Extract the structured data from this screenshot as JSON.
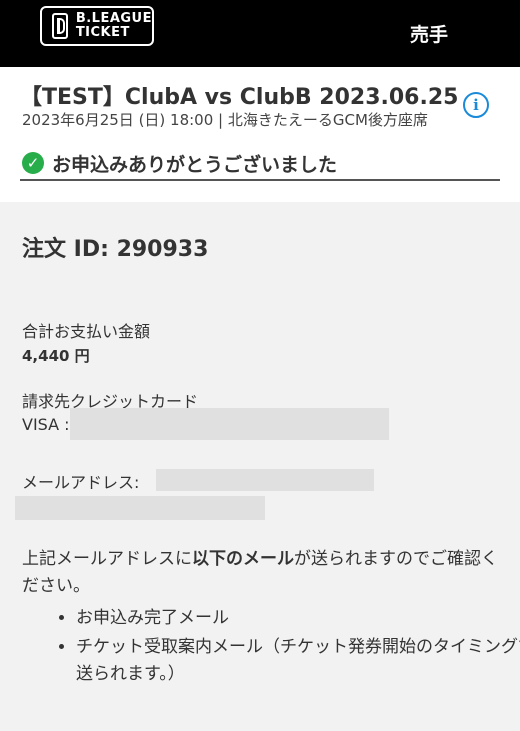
{
  "header": {
    "logo_line1": "B.LEAGUE",
    "logo_line2": "TICKET",
    "seller_label": "売手"
  },
  "event": {
    "title": "【TEST】ClubA vs ClubB 2023.06.25",
    "subtitle": "2023年6月25日 (日) 18:00 | 北海きたえーるGCM後方座席",
    "info_icon": "i"
  },
  "confirmation": {
    "message": "お申込みありがとうございました",
    "check_icon": "✓"
  },
  "order": {
    "id_label": "注文 ID: 290933",
    "total_label": "合計お支払い金額",
    "total_value": "4,440 円",
    "card_label": "請求先クレジットカード",
    "card_prefix": "VISA :",
    "email_label": "メールアドレス:"
  },
  "notice": {
    "text_before": "上記メールアドレスに",
    "text_bold": "以下のメール",
    "text_after": "が送られますのでご確認ください。",
    "items": [
      "お申込み完了メール",
      "チケット受取案内メール（チケット発券開始のタイミングで送られます。）"
    ]
  }
}
